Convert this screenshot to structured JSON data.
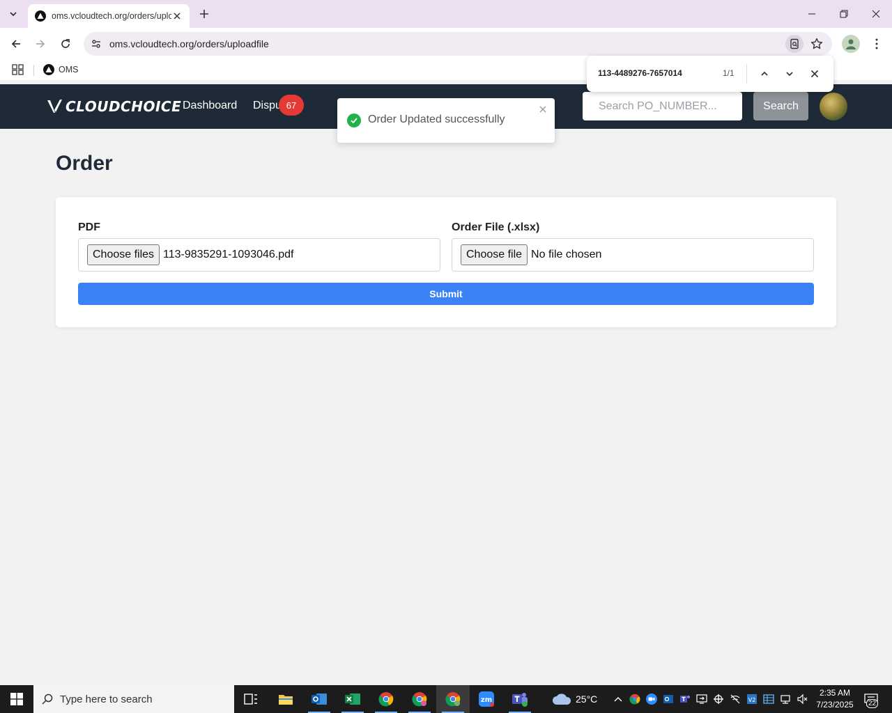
{
  "browser": {
    "tab_title": "oms.vcloudtech.org/orders/uploadfile",
    "url": "oms.vcloudtech.org/orders/uploadfile",
    "bookmark_label": "OMS"
  },
  "find_bar": {
    "query": "113-4489276-7657014",
    "count": "1/1"
  },
  "app": {
    "logo_text": "CLOUDCHOICE",
    "nav": {
      "dashboard_label": "Dashboard",
      "disputes_label": "Dispu",
      "disputes_badge": "67"
    },
    "search": {
      "placeholder": "Search PO_NUMBER...",
      "button_label": "Search"
    },
    "page_title": "Order",
    "form": {
      "pdf_label": "PDF",
      "pdf_button": "Choose files",
      "pdf_value": "113-9835291-1093046.pdf",
      "order_label": "Order File (.xlsx)",
      "order_button": "Choose file",
      "order_value": "No file chosen",
      "submit_label": "Submit"
    },
    "toast": {
      "message": "Order Updated successfully"
    },
    "colors": {
      "nav_bg": "#1f2a38",
      "submit_bg": "#3b82f6",
      "badge_bg": "#e53935",
      "toast_success": "#22b14c"
    }
  },
  "taskbar": {
    "search_placeholder": "Type here to search",
    "weather": "25°C",
    "time": "2:35 AM",
    "date": "7/23/2025",
    "notification_count": "22"
  }
}
